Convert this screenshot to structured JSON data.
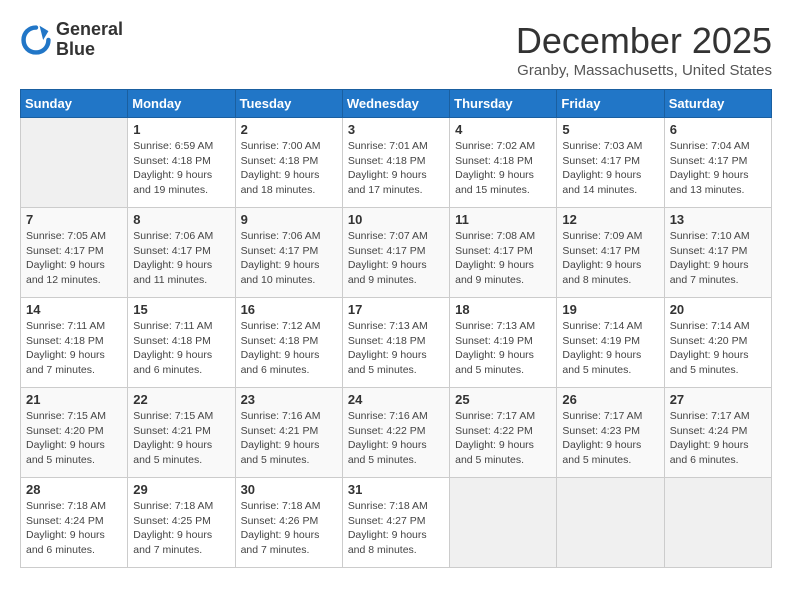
{
  "logo": {
    "line1": "General",
    "line2": "Blue"
  },
  "title": "December 2025",
  "subtitle": "Granby, Massachusetts, United States",
  "days_of_week": [
    "Sunday",
    "Monday",
    "Tuesday",
    "Wednesday",
    "Thursday",
    "Friday",
    "Saturday"
  ],
  "weeks": [
    [
      {
        "num": "",
        "info": ""
      },
      {
        "num": "1",
        "info": "Sunrise: 6:59 AM\nSunset: 4:18 PM\nDaylight: 9 hours\nand 19 minutes."
      },
      {
        "num": "2",
        "info": "Sunrise: 7:00 AM\nSunset: 4:18 PM\nDaylight: 9 hours\nand 18 minutes."
      },
      {
        "num": "3",
        "info": "Sunrise: 7:01 AM\nSunset: 4:18 PM\nDaylight: 9 hours\nand 17 minutes."
      },
      {
        "num": "4",
        "info": "Sunrise: 7:02 AM\nSunset: 4:18 PM\nDaylight: 9 hours\nand 15 minutes."
      },
      {
        "num": "5",
        "info": "Sunrise: 7:03 AM\nSunset: 4:17 PM\nDaylight: 9 hours\nand 14 minutes."
      },
      {
        "num": "6",
        "info": "Sunrise: 7:04 AM\nSunset: 4:17 PM\nDaylight: 9 hours\nand 13 minutes."
      }
    ],
    [
      {
        "num": "7",
        "info": "Sunrise: 7:05 AM\nSunset: 4:17 PM\nDaylight: 9 hours\nand 12 minutes."
      },
      {
        "num": "8",
        "info": "Sunrise: 7:06 AM\nSunset: 4:17 PM\nDaylight: 9 hours\nand 11 minutes."
      },
      {
        "num": "9",
        "info": "Sunrise: 7:06 AM\nSunset: 4:17 PM\nDaylight: 9 hours\nand 10 minutes."
      },
      {
        "num": "10",
        "info": "Sunrise: 7:07 AM\nSunset: 4:17 PM\nDaylight: 9 hours\nand 9 minutes."
      },
      {
        "num": "11",
        "info": "Sunrise: 7:08 AM\nSunset: 4:17 PM\nDaylight: 9 hours\nand 9 minutes."
      },
      {
        "num": "12",
        "info": "Sunrise: 7:09 AM\nSunset: 4:17 PM\nDaylight: 9 hours\nand 8 minutes."
      },
      {
        "num": "13",
        "info": "Sunrise: 7:10 AM\nSunset: 4:17 PM\nDaylight: 9 hours\nand 7 minutes."
      }
    ],
    [
      {
        "num": "14",
        "info": "Sunrise: 7:11 AM\nSunset: 4:18 PM\nDaylight: 9 hours\nand 7 minutes."
      },
      {
        "num": "15",
        "info": "Sunrise: 7:11 AM\nSunset: 4:18 PM\nDaylight: 9 hours\nand 6 minutes."
      },
      {
        "num": "16",
        "info": "Sunrise: 7:12 AM\nSunset: 4:18 PM\nDaylight: 9 hours\nand 6 minutes."
      },
      {
        "num": "17",
        "info": "Sunrise: 7:13 AM\nSunset: 4:18 PM\nDaylight: 9 hours\nand 5 minutes."
      },
      {
        "num": "18",
        "info": "Sunrise: 7:13 AM\nSunset: 4:19 PM\nDaylight: 9 hours\nand 5 minutes."
      },
      {
        "num": "19",
        "info": "Sunrise: 7:14 AM\nSunset: 4:19 PM\nDaylight: 9 hours\nand 5 minutes."
      },
      {
        "num": "20",
        "info": "Sunrise: 7:14 AM\nSunset: 4:20 PM\nDaylight: 9 hours\nand 5 minutes."
      }
    ],
    [
      {
        "num": "21",
        "info": "Sunrise: 7:15 AM\nSunset: 4:20 PM\nDaylight: 9 hours\nand 5 minutes."
      },
      {
        "num": "22",
        "info": "Sunrise: 7:15 AM\nSunset: 4:21 PM\nDaylight: 9 hours\nand 5 minutes."
      },
      {
        "num": "23",
        "info": "Sunrise: 7:16 AM\nSunset: 4:21 PM\nDaylight: 9 hours\nand 5 minutes."
      },
      {
        "num": "24",
        "info": "Sunrise: 7:16 AM\nSunset: 4:22 PM\nDaylight: 9 hours\nand 5 minutes."
      },
      {
        "num": "25",
        "info": "Sunrise: 7:17 AM\nSunset: 4:22 PM\nDaylight: 9 hours\nand 5 minutes."
      },
      {
        "num": "26",
        "info": "Sunrise: 7:17 AM\nSunset: 4:23 PM\nDaylight: 9 hours\nand 5 minutes."
      },
      {
        "num": "27",
        "info": "Sunrise: 7:17 AM\nSunset: 4:24 PM\nDaylight: 9 hours\nand 6 minutes."
      }
    ],
    [
      {
        "num": "28",
        "info": "Sunrise: 7:18 AM\nSunset: 4:24 PM\nDaylight: 9 hours\nand 6 minutes."
      },
      {
        "num": "29",
        "info": "Sunrise: 7:18 AM\nSunset: 4:25 PM\nDaylight: 9 hours\nand 7 minutes."
      },
      {
        "num": "30",
        "info": "Sunrise: 7:18 AM\nSunset: 4:26 PM\nDaylight: 9 hours\nand 7 minutes."
      },
      {
        "num": "31",
        "info": "Sunrise: 7:18 AM\nSunset: 4:27 PM\nDaylight: 9 hours\nand 8 minutes."
      },
      {
        "num": "",
        "info": ""
      },
      {
        "num": "",
        "info": ""
      },
      {
        "num": "",
        "info": ""
      }
    ]
  ]
}
